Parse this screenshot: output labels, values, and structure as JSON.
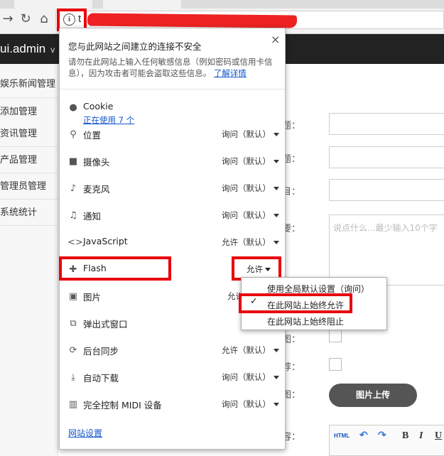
{
  "browser": {
    "omnibox_text": "t"
  },
  "app": {
    "brand": "ui.admin",
    "brand_suffix": "v"
  },
  "sidebar": {
    "items": [
      "娱乐新闻管理",
      "添加管理",
      "资讯管理",
      "产品管理",
      "管理员管理",
      "系统统计"
    ]
  },
  "form": {
    "labels": [
      "标题：",
      "标题：",
      "栏目：",
      "摘要：",
      "本图：",
      "推荐：",
      "略图：",
      "内容："
    ],
    "summary_placeholder": "说点什么...最少输入10个字",
    "upload_button": "图片上传",
    "editor_toolbar": [
      "HTML",
      "B",
      "I",
      "U"
    ]
  },
  "popup": {
    "close_label": "×",
    "warning_title": "您与此网站之间建立的连接不安全",
    "warning_text": "请勿在此网站上输入任何敏感信息（例如密码或信用卡信息），因为攻击者可能会盗取这些信息。",
    "learn_more": "了解详情",
    "cookie_label": "Cookie",
    "cookie_sub": "正在使用 7 个",
    "permissions": [
      {
        "name": "位置",
        "value": "询问（默认）",
        "icon": "location-pin-icon"
      },
      {
        "name": "摄像头",
        "value": "询问（默认）",
        "icon": "camera-icon"
      },
      {
        "name": "麦克风",
        "value": "询问（默认）",
        "icon": "microphone-icon"
      },
      {
        "name": "通知",
        "value": "询问（默认）",
        "icon": "bell-icon"
      },
      {
        "name": "JavaScript",
        "value": "允许（默认）",
        "icon": "code-icon"
      },
      {
        "name": "Flash",
        "value": "允许",
        "icon": "puzzle-icon"
      },
      {
        "name": "图片",
        "value": "允许",
        "icon": "image-icon"
      },
      {
        "name": "弹出式窗口",
        "value": "",
        "icon": "popup-icon"
      },
      {
        "name": "后台同步",
        "value": "允许（默认）",
        "icon": "sync-icon"
      },
      {
        "name": "自动下载",
        "value": "询问（默认）",
        "icon": "download-icon"
      },
      {
        "name": "完全控制 MIDI 设备",
        "value": "询问（默认）",
        "icon": "midi-icon"
      }
    ],
    "site_settings": "网站设置"
  },
  "flash_dropdown": {
    "options": [
      "使用全局默认设置（询问）",
      "在此网站上始终允许",
      "在此网站上始终阻止"
    ],
    "selected": "在此网站上始终允许"
  },
  "colors": {
    "highlight": "#e8000b",
    "link": "#1155cc",
    "topbar": "#222222"
  }
}
